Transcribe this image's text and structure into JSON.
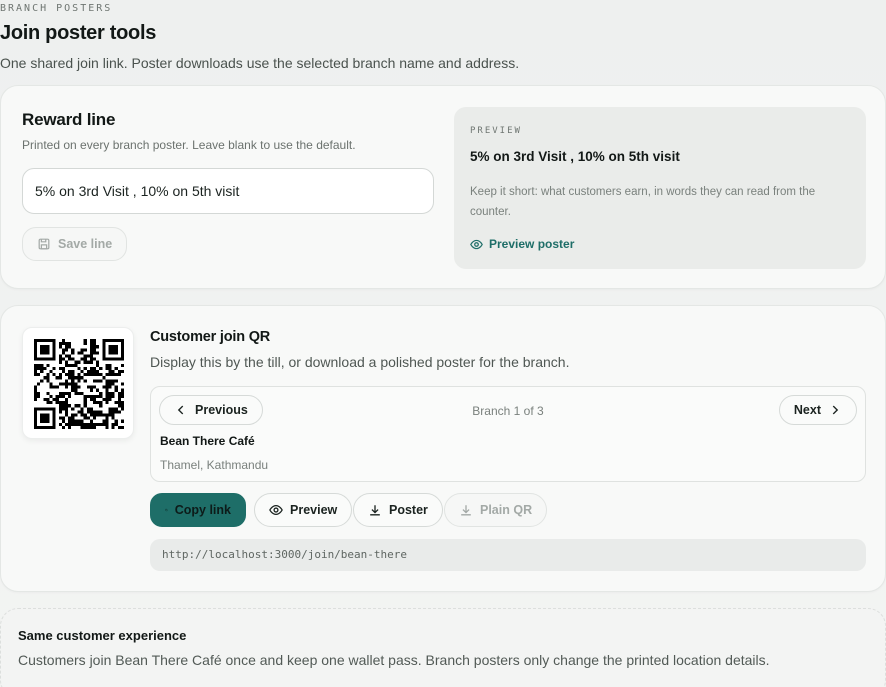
{
  "header": {
    "eyebrow": "BRANCH POSTERS",
    "title": "Join poster tools",
    "subtitle": "One shared join link. Poster downloads use the selected branch name and address."
  },
  "reward": {
    "title": "Reward line",
    "description": "Printed on every branch poster. Leave blank to use the default.",
    "input_value": "5% on 3rd Visit , 10% on 5th visit",
    "save_label": "Save line",
    "preview": {
      "eyebrow": "PREVIEW",
      "line": "5% on 3rd Visit , 10% on 5th visit",
      "hint": "Keep it short: what customers earn, in words they can read from the counter.",
      "link_label": "Preview poster"
    }
  },
  "qr_section": {
    "title": "Customer join QR",
    "description": "Display this by the till, or download a polished poster for the branch.",
    "branch": {
      "prev_label": "Previous",
      "next_label": "Next",
      "counter": "Branch 1 of 3",
      "name": "Bean There Café",
      "address": "Thamel, Kathmandu"
    },
    "actions": {
      "copy_label": "Copy link",
      "preview_label": "Preview",
      "poster_label": "Poster",
      "plain_qr_label": "Plain QR"
    },
    "url": "http://localhost:3000/join/bean-there"
  },
  "note": {
    "title": "Same customer experience",
    "text": "Customers join Bean There Café once and keep one wallet pass. Branch posters only change the printed location details."
  },
  "colors": {
    "accent": "#1e6e68",
    "background": "#eef0ef",
    "card": "#f8f9f8"
  }
}
